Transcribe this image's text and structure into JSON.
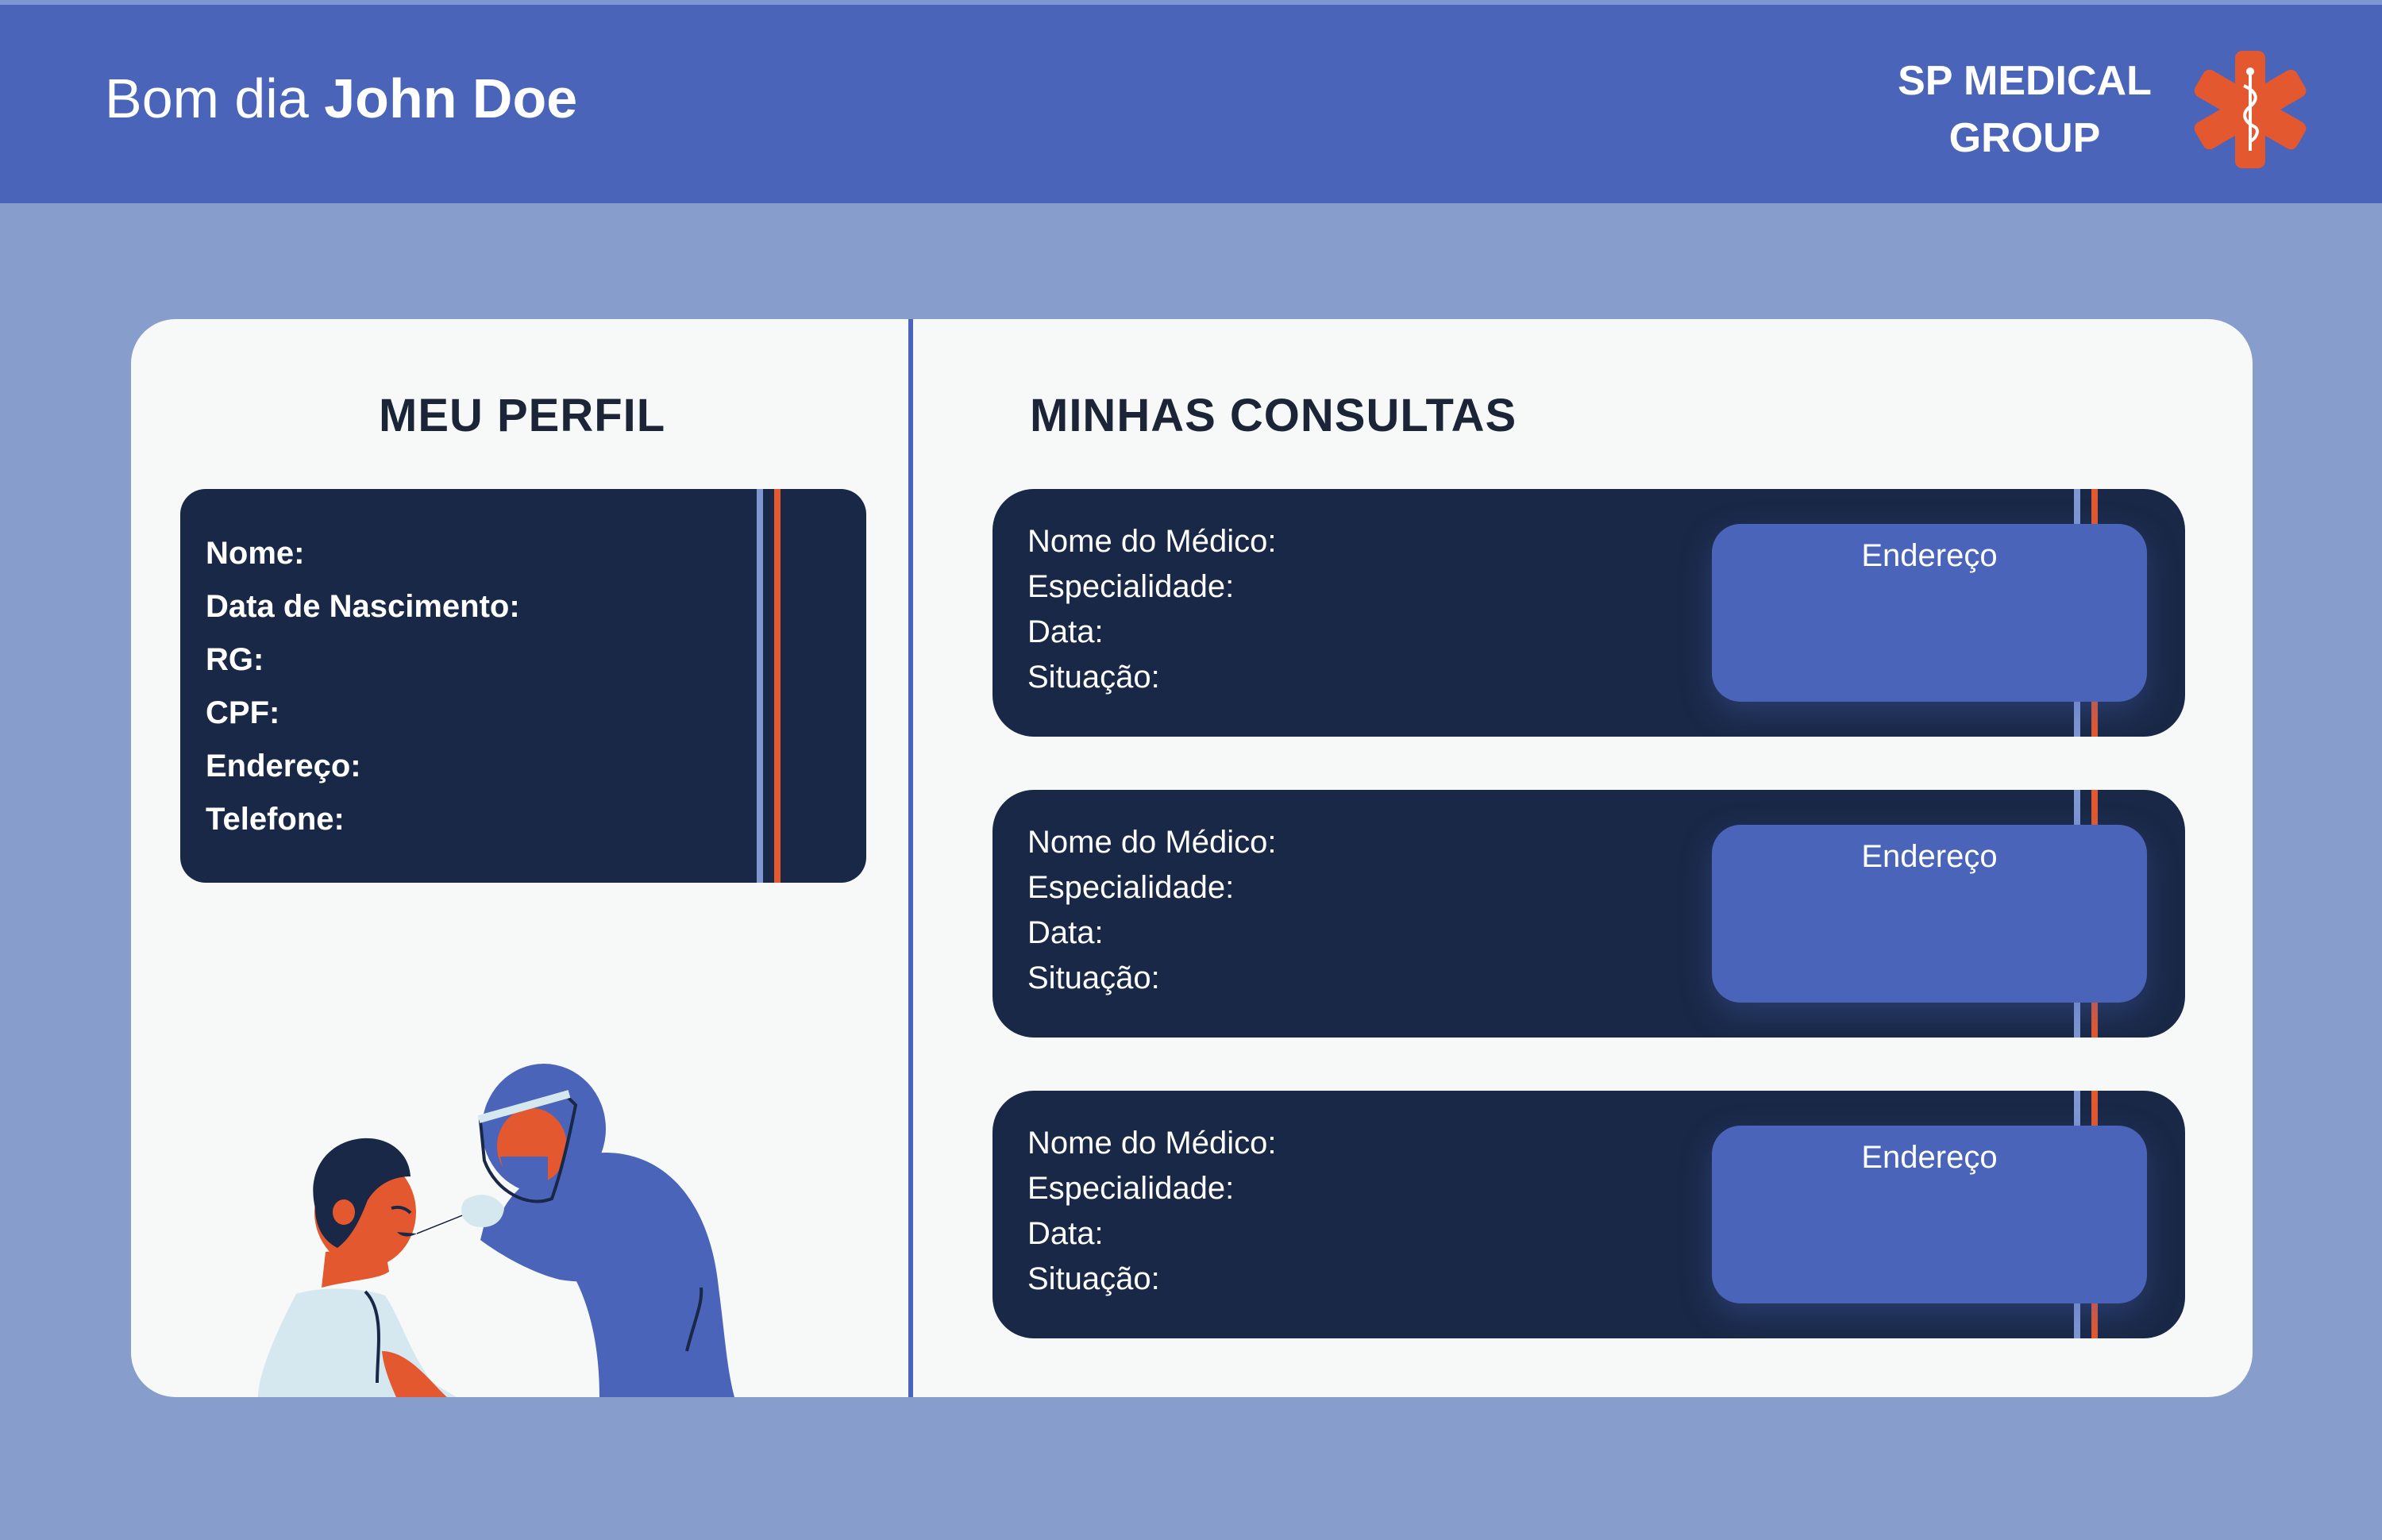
{
  "header": {
    "greeting": "Bom dia",
    "user_name": "John Doe",
    "brand_line1": "SP MEDICAL",
    "brand_line2": "GROUP",
    "logo_icon": "star-of-life-icon"
  },
  "profile": {
    "title": "MEU PERFIL",
    "fields": {
      "name_label": "Nome:",
      "birth_label": "Data de Nascimento:",
      "rg_label": "RG:",
      "cpf_label": "CPF:",
      "address_label": "Endereço:",
      "phone_label": "Telefone:"
    }
  },
  "consultations": {
    "title": "MINHAS CONSULTAS",
    "items": [
      {
        "doctor_label": "Nome do Médico:",
        "specialty_label": "Especialidade:",
        "date_label": "Data:",
        "status_label": "Situação:",
        "address_button": "Endereço"
      },
      {
        "doctor_label": "Nome do Médico:",
        "specialty_label": "Especialidade:",
        "date_label": "Data:",
        "status_label": "Situação:",
        "address_button": "Endereço"
      },
      {
        "doctor_label": "Nome do Médico:",
        "specialty_label": "Especialidade:",
        "date_label": "Data:",
        "status_label": "Situação:",
        "address_button": "Endereço"
      }
    ]
  },
  "colors": {
    "background": "#879dcb",
    "header": "#4a64ba",
    "panel": "#f7f9f9",
    "card": "#192846",
    "accent_orange": "#e4582f",
    "accent_light": "#7f97d3"
  }
}
